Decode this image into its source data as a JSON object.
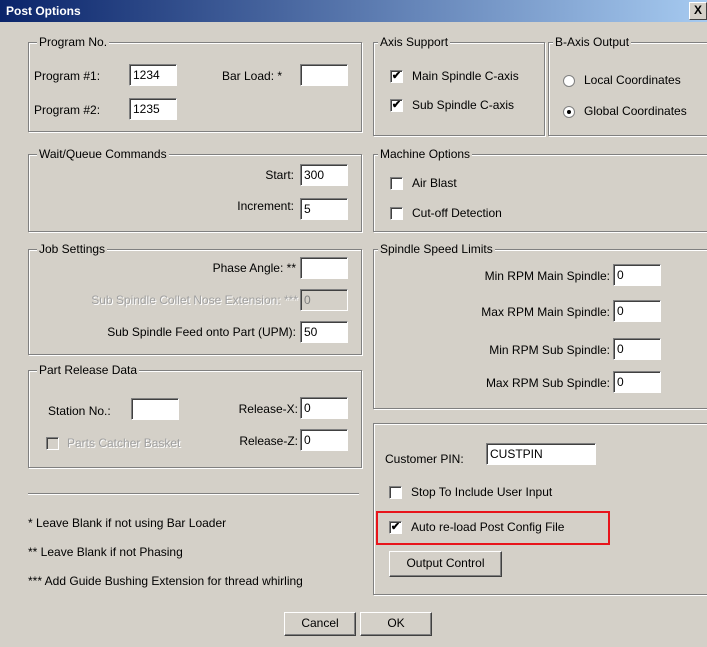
{
  "window": {
    "title": "Post Options",
    "close_glyph": "X"
  },
  "program_no": {
    "legend": "Program No.",
    "program1_label": "Program #1:",
    "program1_value": "1234",
    "program2_label": "Program #2:",
    "program2_value": "1235",
    "bar_load_label": "Bar Load: *",
    "bar_load_value": ""
  },
  "axis_support": {
    "legend": "Axis Support",
    "main_spindle_c_axis": {
      "label": "Main Spindle C-axis",
      "checked": true
    },
    "sub_spindle_c_axis": {
      "label": "Sub Spindle C-axis",
      "checked": true
    }
  },
  "b_axis_output": {
    "legend": "B-Axis Output",
    "local": {
      "label": "Local Coordinates",
      "selected": false
    },
    "global": {
      "label": "Global Coordinates",
      "selected": true
    }
  },
  "wait_queue": {
    "legend": "Wait/Queue Commands",
    "start_label": "Start:",
    "start_value": "300",
    "increment_label": "Increment:",
    "increment_value": "5"
  },
  "machine_options": {
    "legend": "Machine Options",
    "air_blast": {
      "label": "Air Blast",
      "checked": false
    },
    "cutoff_detection": {
      "label": "Cut-off Detection",
      "checked": false
    }
  },
  "job_settings": {
    "legend": "Job Settings",
    "phase_angle_label": "Phase Angle: **",
    "phase_angle_value": "",
    "collet_label": "Sub Spindle Collet Nose Extension: ***",
    "collet_value": "0",
    "feed_label": "Sub Spindle Feed onto Part (UPM):",
    "feed_value": "50"
  },
  "spindle_speed_limits": {
    "legend": "Spindle Speed Limits",
    "min_main_label": "Min RPM Main Spindle:",
    "min_main_value": "0",
    "max_main_label": "Max RPM Main Spindle:",
    "max_main_value": "0",
    "min_sub_label": "Min RPM Sub Spindle:",
    "min_sub_value": "0",
    "max_sub_label": "Max RPM Sub Spindle:",
    "max_sub_value": "0"
  },
  "part_release": {
    "legend": "Part Release Data",
    "station_label": "Station No.:",
    "station_value": "",
    "release_x_label": "Release-X:",
    "release_x_value": "0",
    "release_z_label": "Release-Z:",
    "release_z_value": "0",
    "parts_catcher": {
      "label": "Parts Catcher Basket",
      "checked": false
    }
  },
  "customer": {
    "pin_label": "Customer PIN:",
    "pin_value": "CUSTPIN",
    "stop_user_input": {
      "label": "Stop To Include User Input",
      "checked": false
    },
    "auto_reload": {
      "label": "Auto re-load Post Config File",
      "checked": true
    },
    "output_control_label": "Output Control"
  },
  "notes": [
    "* Leave Blank if not using Bar Loader",
    "** Leave Blank if not Phasing",
    "*** Add Guide Bushing Extension for thread whirling"
  ],
  "buttons": {
    "cancel": "Cancel",
    "ok": "OK"
  },
  "colors": {
    "highlight_box": "#e8141b",
    "title_start": "#0a246a",
    "title_end": "#a6caf0"
  },
  "check_glyph": "✔"
}
